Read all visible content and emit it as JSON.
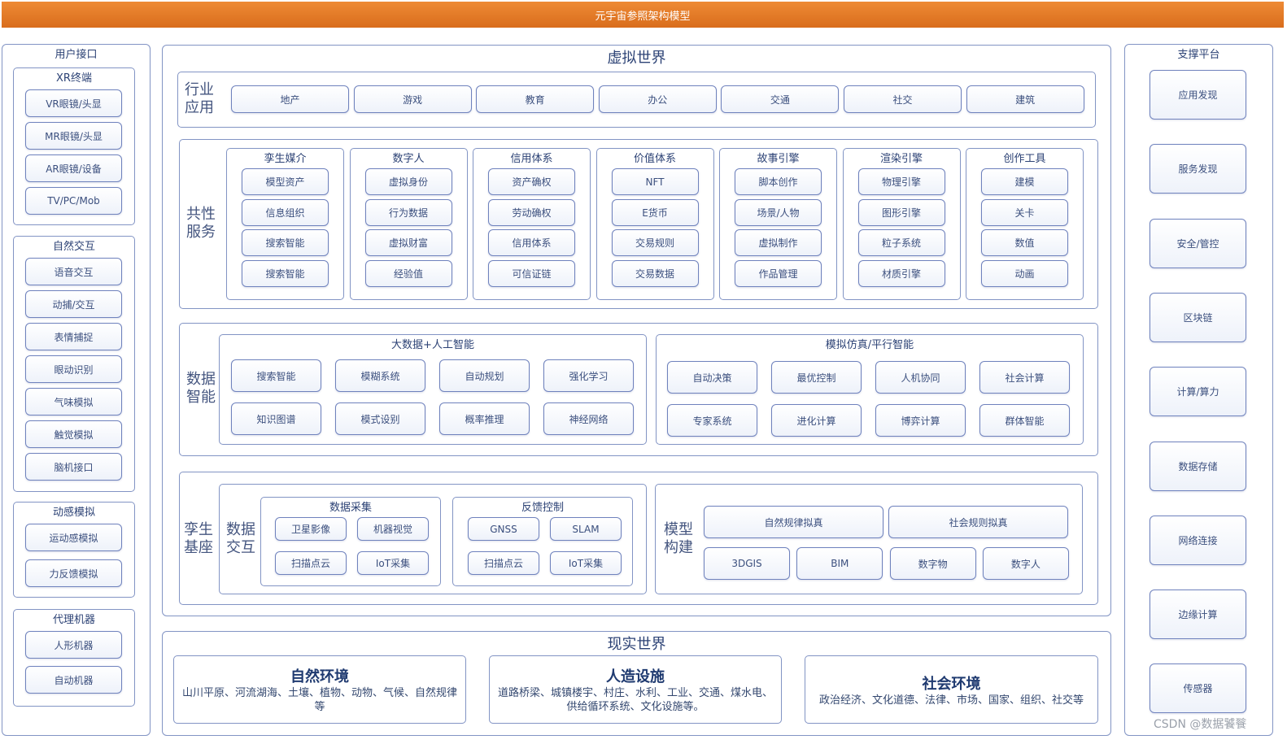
{
  "title": "元宇宙参照架构模型",
  "user_interface": {
    "title": "用户接口",
    "xr": {
      "title": "XR终端",
      "items": [
        "VR眼镜/头显",
        "MR眼镜/头显",
        "AR眼镜/设备",
        "TV/PC/Mob"
      ]
    },
    "natural": {
      "title": "自然交互",
      "items": [
        "语音交互",
        "动捕/交互",
        "表情捕捉",
        "眼动识别",
        "气味模拟",
        "触觉模拟",
        "脑机接口"
      ]
    },
    "motion": {
      "title": "动感模拟",
      "items": [
        "运动感模拟",
        "力反馈模拟"
      ]
    },
    "robot": {
      "title": "代理机器",
      "items": [
        "人形机器",
        "自动机器"
      ]
    }
  },
  "virtual_world": {
    "title": "虚拟世界",
    "industry": {
      "label": "行业\n应用",
      "items": [
        "地产",
        "游戏",
        "教育",
        "办公",
        "交通",
        "社交",
        "建筑"
      ]
    },
    "common": {
      "label": "共性\n服务",
      "groups": [
        {
          "title": "孪生媒介",
          "items": [
            "模型资产",
            "信息组织",
            "搜索智能",
            "搜索智能"
          ]
        },
        {
          "title": "数字人",
          "items": [
            "虚拟身份",
            "行为数据",
            "虚拟财富",
            "经验值"
          ]
        },
        {
          "title": "信用体系",
          "items": [
            "资产确权",
            "劳动确权",
            "信用体系",
            "可信证链"
          ]
        },
        {
          "title": "价值体系",
          "items": [
            "NFT",
            "E货币",
            "交易规则",
            "交易数据"
          ]
        },
        {
          "title": "故事引擎",
          "items": [
            "脚本创作",
            "场景/人物",
            "虚拟制作",
            "作品管理"
          ]
        },
        {
          "title": "渲染引擎",
          "items": [
            "物理引擎",
            "图形引擎",
            "粒子系统",
            "材质引擎"
          ]
        },
        {
          "title": "创作工具",
          "items": [
            "建模",
            "关卡",
            "数值",
            "动画"
          ]
        }
      ]
    },
    "data_intel": {
      "label": "数据\n智能",
      "ai": {
        "title": "大数据+人工智能",
        "items": [
          "搜索智能",
          "模糊系统",
          "自动规划",
          "强化学习",
          "知识图谱",
          "模式设别",
          "概率推理",
          "神经网络"
        ]
      },
      "sim": {
        "title": "模拟仿真/平行智能",
        "items": [
          "自动决策",
          "最优控制",
          "人机协同",
          "社会计算",
          "专家系统",
          "进化计算",
          "博弈计算",
          "群体智能"
        ]
      }
    },
    "twin": {
      "label": "孪生\n基座",
      "interact_label": "数据\n交互",
      "collect": {
        "title": "数据采集",
        "items": [
          "卫星影像",
          "机器视觉",
          "扫描点云",
          "IoT采集"
        ]
      },
      "feedback": {
        "title": "反馈控制",
        "items": [
          "GNSS",
          "SLAM",
          "扫描点云",
          "IoT采集"
        ]
      },
      "model_label": "模型\n构建",
      "model_top": [
        "自然规律拟真",
        "社会规则拟真"
      ],
      "model_bottom": [
        "3DGIS",
        "BIM",
        "数字物",
        "数字人"
      ]
    }
  },
  "real_world": {
    "title": "现实世界",
    "items": [
      {
        "head": "自然环境",
        "text": "山川平原、河流湖海、土壤、植物、动物、气候、自然规律等"
      },
      {
        "head": "人造设施",
        "text": "道路桥梁、城镇楼宇、村庄、水利、工业、交通、煤水电、供给循环系统、文化设施等。"
      },
      {
        "head": "社会环境",
        "text": "政治经济、文化道德、法律、市场、国家、组织、社交等"
      }
    ]
  },
  "support": {
    "title": "支撑平台",
    "items": [
      "应用发现",
      "服务发现",
      "安全/管控",
      "区块链",
      "计算/算力",
      "数据存储",
      "网络连接",
      "边缘计算",
      "传感器"
    ]
  },
  "watermark": "CSDN @数据饕餮"
}
